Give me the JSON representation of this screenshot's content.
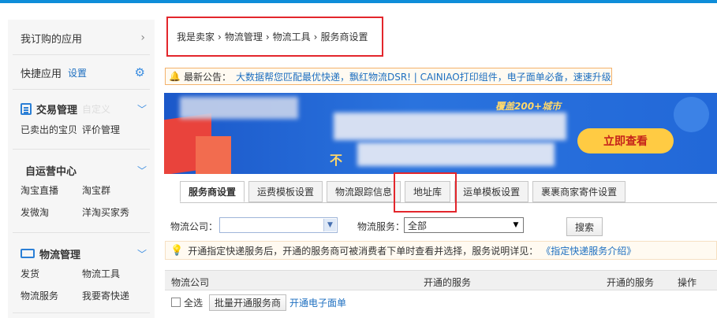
{
  "sidebar": {
    "my_apps": "我订购的应用",
    "quick_apps": "快捷应用",
    "quick_settings": "设置",
    "trade": {
      "title": "交易管理",
      "sub": "自定义",
      "items": [
        "已卖出的宝贝",
        "评价管理"
      ]
    },
    "self_run": {
      "title": "自运营中心",
      "items": [
        "淘宝直播",
        "淘宝群",
        "发微淘",
        "洋淘买家秀"
      ]
    },
    "logistics": {
      "title": "物流管理",
      "items": [
        "发货",
        "物流工具",
        "物流服务",
        "我要寄快递"
      ]
    }
  },
  "breadcrumb": [
    "我是卖家",
    "物流管理",
    "物流工具",
    "服务商设置"
  ],
  "notice": {
    "label": "最新公告：",
    "message": "大数据帮您匹配最优快递，飘红物流DSR! | CAINIAO打印组件，电子面单必备，速速升级"
  },
  "banner": {
    "tag": "覆盖200+城市",
    "prefix": "不",
    "button": "立即查看"
  },
  "tabs": [
    "服务商设置",
    "运费模板设置",
    "物流跟踪信息",
    "地址库",
    "运单模板设置",
    "裹裹商家寄件设置"
  ],
  "filter": {
    "company_label": "物流公司：",
    "company_value": "",
    "service_label": "物流服务：",
    "service_value": "全部",
    "search": "搜索"
  },
  "tip": {
    "text": "开通指定快递服务后，开通的服务商可被消费者下单时查看并选择，服务说明详见：",
    "link": "《指定快递服务介绍》"
  },
  "table": {
    "headers": [
      "物流公司",
      "开通的服务",
      "开通的服务",
      "操作"
    ],
    "select_all": "全选",
    "batch_button": "批量开通服务商",
    "eface_link": "开通电子面单"
  },
  "colors": {
    "accent": "#0e8dd9",
    "link": "#1d6fc0",
    "highlight": "#e3262c"
  }
}
